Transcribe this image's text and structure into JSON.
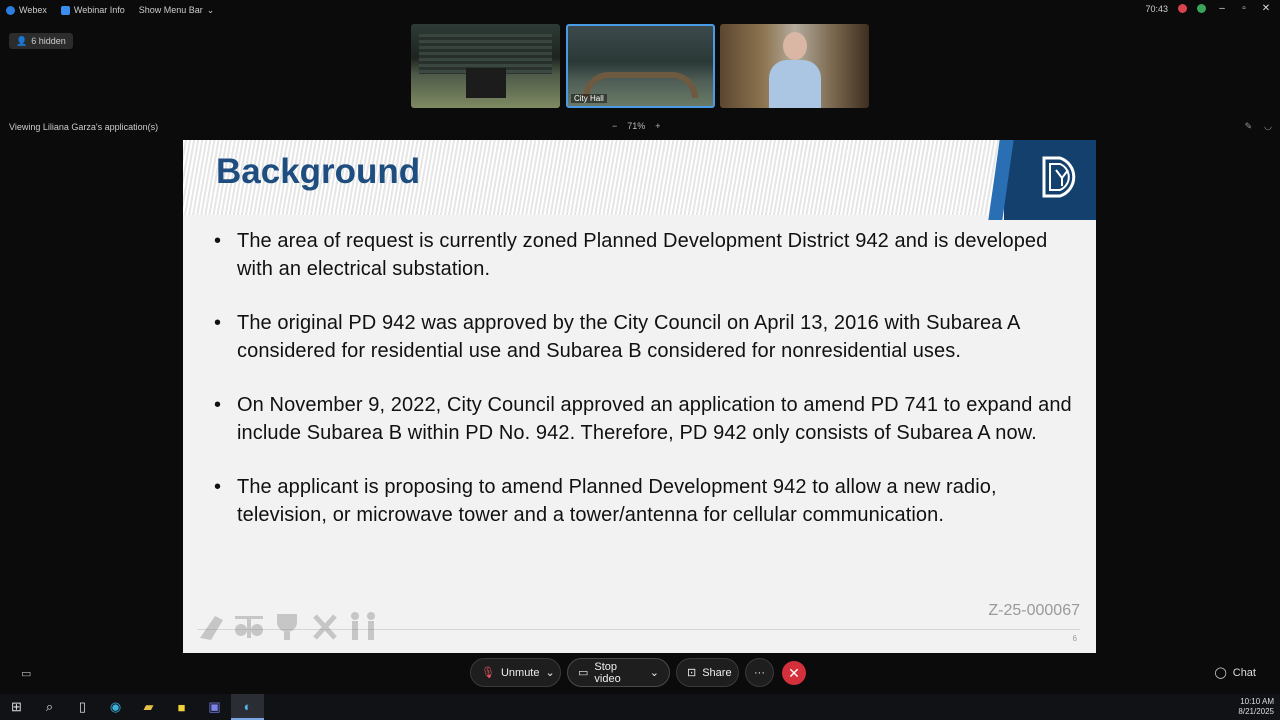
{
  "titlebar": {
    "app": "Webex",
    "webinar_info": "Webinar Info",
    "show_menu_bar": "Show Menu Bar",
    "timer": "70:43"
  },
  "participants": {
    "hidden_label": "6 hidden",
    "thumbs": [
      {
        "label": ""
      },
      {
        "label": "City Hall"
      },
      {
        "label": ""
      }
    ]
  },
  "share": {
    "viewing": "Viewing Liliana Garza's application(s)",
    "zoom_minus": "−",
    "zoom_level": "71%",
    "zoom_plus": "+"
  },
  "slide": {
    "title": "Background",
    "bullets": [
      "The area of request is currently zoned Planned Development District 942 and is developed with an electrical substation.",
      "The original PD 942 was approved by the City Council on April 13, 2016 with Subarea A considered for residential use and Subarea B considered for nonresidential uses.",
      "On November 9, 2022, City Council approved an application to amend PD 741 to expand and include Subarea B within PD No. 942. Therefore, PD  942 only consists of Subarea A now.",
      "The applicant is proposing to amend Planned Development 942 to allow a new radio, television, or microwave tower and a tower/antenna for cellular communication."
    ],
    "case_number": "Z-25-000067",
    "page_number": "6"
  },
  "controls": {
    "unmute": "Unmute",
    "stop_video": "Stop video",
    "share": "Share",
    "more": "···",
    "end": "✕",
    "chat": "Chat"
  },
  "taskbar": {
    "time": "10:10 AM",
    "date": "8/21/2025"
  },
  "colors": {
    "slide_title": "#1e4d80",
    "logo_bg": "#14406e",
    "end_button": "#d3303c"
  }
}
